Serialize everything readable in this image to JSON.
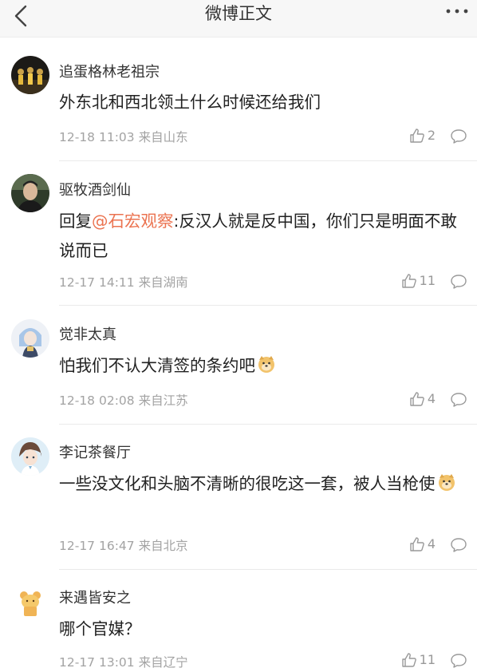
{
  "header": {
    "title": "微博正文",
    "back_icon": "chevron-left-icon",
    "more_icon": "more-dots-icon"
  },
  "comments": [
    {
      "username": "追蛋格林老祖宗",
      "text": "外东北和西北领土什么时候还给我们",
      "timestamp": "12-18 11:03",
      "source": "来自山东",
      "likes": "2"
    },
    {
      "username": "驱牧酒剑仙",
      "reply_prefix": "回复",
      "mention": "@石宏观察",
      "text": ":反汉人就是反中国，你们只是明面不敢说而已",
      "timestamp": "12-17 14:11",
      "source": "来自湖南",
      "likes": "11"
    },
    {
      "username": "觉非太真",
      "text": "怕我们不认大清签的条约吧",
      "emoji": "doge-emoji",
      "timestamp": "12-18 02:08",
      "source": "来自江苏",
      "likes": "4"
    },
    {
      "username": "李记茶餐厅",
      "text": "一些没文化和头脑不清晰的很吃这一套，被人当枪使",
      "emoji": "doge-emoji",
      "timestamp": "12-17 16:47",
      "source": "来自北京",
      "likes": "4"
    },
    {
      "username": "来遇皆安之",
      "text": "哪个官媒？",
      "timestamp": "12-17 13:01",
      "source": "来自辽宁",
      "likes": "11"
    }
  ],
  "colors": {
    "mention": "#eb7350",
    "meta": "#a3a3a3",
    "header_bg": "#f7f7f7"
  }
}
